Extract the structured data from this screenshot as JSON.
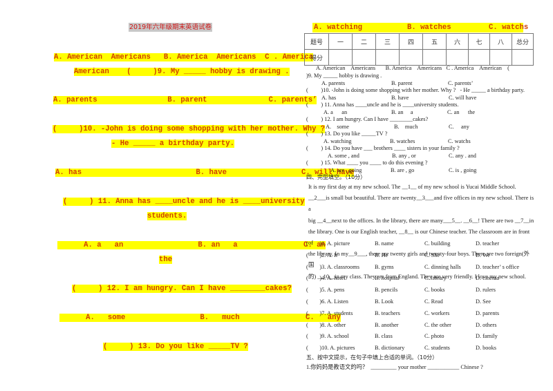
{
  "left_page": {
    "title": "2019年六年级期末英语试卷",
    "lines": [
      "A. American  Americans   B. America  Americans  C . America",
      "American    (     )9. My _____ hobby is drawing .",
      "A. parents                B. parent              C. parents’",
      "(     )10. -John is doing some shopping with her mother. Why ?",
      "- He _____ a birthday party.",
      "A. has                          B. have                 C. will have",
      "(     ) 11. Anna has ____uncle and he is ____university",
      "students.",
      "      A. a   an                 B. an   a               C. an",
      "the",
      "(     ) 12. I am hungry. Can I have ________cakes?",
      "      A.   some                 B.   much               C.   any",
      "(     ) 13. Do you like _____TV ?"
    ]
  },
  "right_page": {
    "top_options": [
      "A. watching",
      "B. watches",
      "C. watchs"
    ],
    "score_table": {
      "header": [
        "题号",
        "一",
        "二",
        "三",
        "四",
        "五",
        "六",
        "七",
        "八",
        "总分"
      ],
      "row_label": "得分"
    },
    "questions": [
      {
        "stem": "      A. American    Americans       B. America    Americans   C . America    American    (",
        "cont": ")9. My _____ hobby is drawing ."
      },
      {
        "options": [
          "A. parents",
          "B. parent",
          "C. parents’"
        ]
      },
      {
        "stem": "(         )10. -John is doing some shopping with her mother. Why ?   - He _____ a birthday party."
      },
      {
        "options": [
          "A. has",
          "B. have",
          "C. will have"
        ]
      },
      {
        "stem": "(         ) 11. Anna has ____uncle and he is ____university students."
      },
      {
        "options": [
          "A. a      an",
          "B. an     a",
          "C. an      the"
        ]
      },
      {
        "stem": "(         ) 12. I am hungry. Can I have ________cakes?"
      },
      {
        "options": [
          "A.    some",
          "B.    much",
          "C.     any"
        ]
      },
      {
        "stem": "(         ) 13. Do you like _____TV ?"
      },
      {
        "options": [
          "A. watching",
          "B. watches",
          "C. watchs"
        ]
      },
      {
        "stem": "(         ) 14. Do you have ___ brothers ____ sisters in your family ?"
      },
      {
        "options": [
          "A. some , and",
          "B. any , or",
          "C. any . and"
        ]
      },
      {
        "stem": "(         ) 15. What ____ you ____ to do this evening ?"
      },
      {
        "options": [
          "A. are , going",
          "B. are , go",
          "C. is , going"
        ]
      }
    ],
    "section4_heading": "四、完型填空。（10分）",
    "passage": [
      "        It is my first day at my new school. The __1__ of my new school is Yucai Middle School.",
      "__2___is small but beautiful. There are twenty__3___and five offices in my new school. There is a",
      "big __4__next to the offices. In the library, there are many___5__. __6__! There are two __7__in",
      "the library. One is our English teacher, __8__ is our Chinese teacher. The classroom are in front of",
      "the library. In my__9___, there are twenty girls and twenty-four boys. There are two foreign(外国",
      "的) __10__in my class. They are from England. They are very friendly. I love my new school."
    ],
    "cloze": [
      {
        "num": "(        )1. A. picture",
        "b": "B. name",
        "c": "C. building",
        "d": "D. teacher"
      },
      {
        "num": "(        )2. A. It",
        "b": "B. He",
        "c": "C. She",
        "d": "D. We"
      },
      {
        "num": "(        )3. A. classrooms",
        "b": "B. gyms",
        "c": "C. dinning halls",
        "d": "D. teacher’ s office"
      },
      {
        "num": "(        )4. A. hotel",
        "b": "B. hospital",
        "c": "C. library",
        "d": "D. cinema"
      },
      {
        "num": "(        )5. A. pens",
        "b": "B. pencils",
        "c": "C. books",
        "d": "D. rulers"
      },
      {
        "num": "(        )6. A. Listen",
        "b": "B. Look",
        "c": "C. Read",
        "d": "D. See"
      },
      {
        "num": "(        )7. A. students",
        "b": "B. teachers",
        "c": "C. workers",
        "d": "D. parents"
      },
      {
        "num": "(        )8. A. other",
        "b": "B. another",
        "c": "C. the other",
        "d": "D. others"
      },
      {
        "num": "(        )9. A. school",
        "b": "B. class",
        "c": "C. photo",
        "d": "D. family"
      },
      {
        "num": "(        )10. A. pictures",
        "b": "B. dictionary",
        "c": "C. students",
        "d": "D. books"
      }
    ],
    "section5_heading": "五、按中文提示，在句子中填上合适的单词。（10分）",
    "section5_q1": "1.你妈妈是教语文的吗？  _________ your mother ___________ Chinese ?"
  }
}
